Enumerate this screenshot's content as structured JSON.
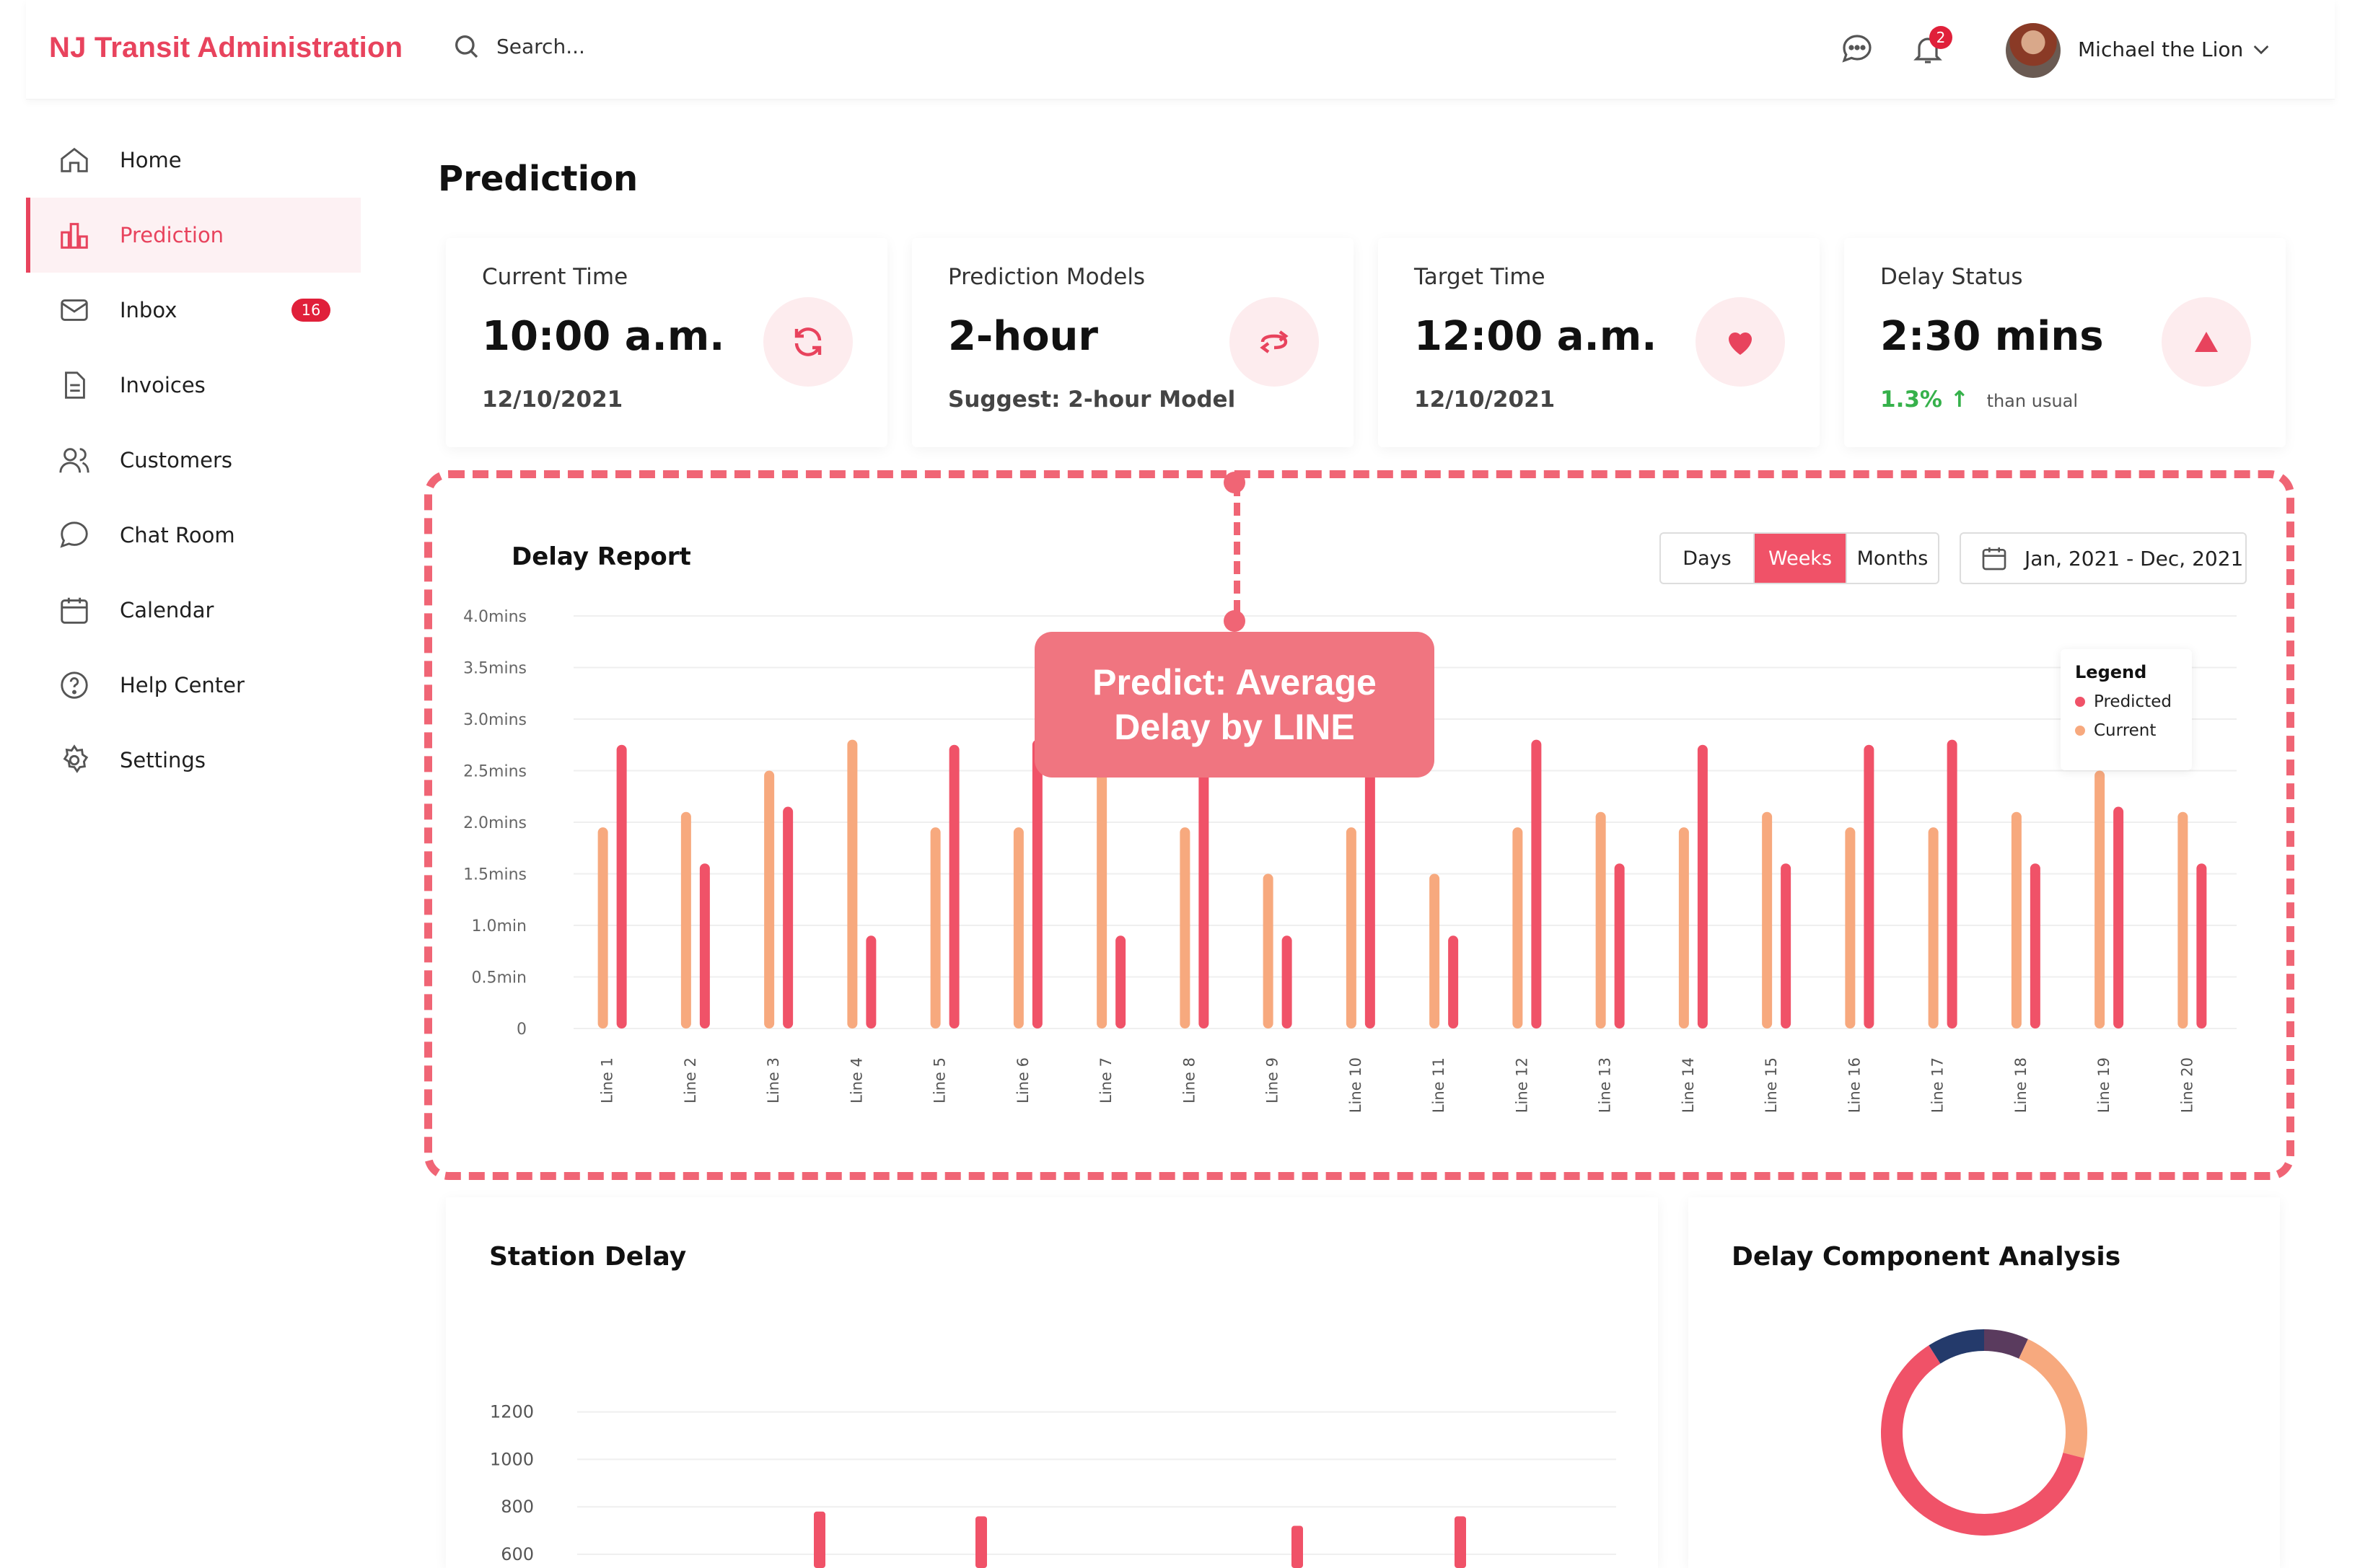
{
  "brand": "NJ Transit Administration",
  "search": {
    "placeholder": "Search..."
  },
  "header": {
    "notification_count": "2",
    "user_name": "Michael the Lion"
  },
  "sidebar": {
    "items": [
      {
        "label": "Home",
        "icon": "home-icon"
      },
      {
        "label": "Prediction",
        "icon": "bar-chart-icon",
        "active": true
      },
      {
        "label": "Inbox",
        "icon": "mail-icon",
        "badge": "16"
      },
      {
        "label": "Invoices",
        "icon": "document-icon"
      },
      {
        "label": "Customers",
        "icon": "users-icon"
      },
      {
        "label": "Chat Room",
        "icon": "chat-icon"
      },
      {
        "label": "Calendar",
        "icon": "calendar-icon"
      },
      {
        "label": "Help Center",
        "icon": "help-icon"
      },
      {
        "label": "Settings",
        "icon": "gear-icon"
      }
    ]
  },
  "page": {
    "title": "Prediction"
  },
  "cards": [
    {
      "title": "Current Time",
      "value": "10:00 a.m.",
      "sub": "12/10/2021",
      "icon": "refresh-icon"
    },
    {
      "title": "Prediction Models",
      "value": "2-hour",
      "sub": "Suggest: 2-hour Model",
      "icon": "swap-icon"
    },
    {
      "title": "Target Time",
      "value": "12:00 a.m.",
      "sub": "12/10/2021",
      "icon": "heart-icon"
    },
    {
      "title": "Delay Status",
      "value": "2:30 mins",
      "pct": "1.3%",
      "pct_suffix": "than usual",
      "icon": "triangle-up-icon"
    }
  ],
  "report": {
    "title": "Delay Report",
    "segments": [
      "Days",
      "Weeks",
      "Months"
    ],
    "selected_segment": "Weeks",
    "date_range": "Jan, 2021 - Dec, 2021",
    "callout": "Predict: Average Delay by LINE",
    "legend_title": "Legend"
  },
  "colors": {
    "accent": "#e8435d",
    "predicted": "#f05268",
    "current": "#f7a97e",
    "positive": "#36b14b"
  },
  "chart_data": [
    {
      "type": "bar",
      "title": "Delay Report",
      "categories": [
        "Line 1",
        "Line 2",
        "Line 3",
        "Line 4",
        "Line 5",
        "Line 6",
        "Line 7",
        "Line 8",
        "Line 9",
        "Line 10",
        "Line 11",
        "Line 12",
        "Line 13",
        "Line 14",
        "Line 15",
        "Line 16",
        "Line 17",
        "Line 18",
        "Line 19",
        "Line 20"
      ],
      "y_ticks": [
        "0",
        "0.5min",
        "1.0min",
        "1.5mins",
        "2.0mins",
        "2.5mins",
        "3.0mins",
        "3.5mins",
        "4.0mins"
      ],
      "ylim": [
        0,
        4.0
      ],
      "series": [
        {
          "name": "Current",
          "values": [
            1.95,
            2.1,
            2.5,
            2.8,
            1.95,
            1.95,
            2.8,
            1.95,
            1.5,
            1.95,
            1.5,
            1.95,
            2.1,
            1.95,
            2.1,
            1.95,
            1.95,
            2.1,
            2.5,
            2.1
          ]
        },
        {
          "name": "Predicted",
          "values": [
            2.75,
            1.6,
            2.15,
            0.9,
            2.75,
            2.8,
            0.9,
            2.8,
            0.9,
            2.8,
            0.9,
            2.8,
            1.6,
            2.75,
            1.6,
            2.75,
            2.8,
            1.6,
            2.15,
            1.6
          ]
        }
      ],
      "grid": true,
      "legend": "top-right"
    },
    {
      "type": "bar",
      "title": "Station Delay",
      "y_ticks": [
        "600",
        "800",
        "1000",
        "1200"
      ],
      "ylim": [
        600,
        1300
      ],
      "values": [
        780,
        760,
        720,
        760
      ]
    },
    {
      "type": "pie",
      "title": "Delay Component Analysis",
      "donut": true,
      "slices": [
        {
          "value": 62,
          "color": "#f05268"
        },
        {
          "value": 22,
          "color": "#f7a97e"
        },
        {
          "value": 7,
          "color": "#5a3b5e"
        },
        {
          "value": 9,
          "color": "#243a6b"
        }
      ]
    }
  ],
  "station": {
    "title": "Station Delay"
  },
  "donut": {
    "title": "Delay Component Analysis"
  }
}
